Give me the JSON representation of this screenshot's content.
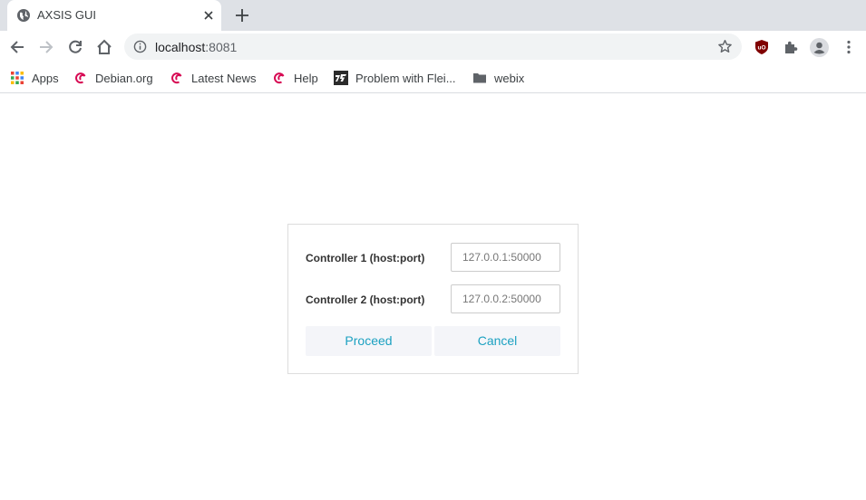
{
  "tab": {
    "title": "AXSIS GUI",
    "favicon": "globe-icon"
  },
  "omnibox": {
    "host": "localhost",
    "port": ":8081"
  },
  "bookmarks": [
    {
      "label": "Apps",
      "icon": "apps-grid-icon"
    },
    {
      "label": "Debian.org",
      "icon": "debian-swirl-icon"
    },
    {
      "label": "Latest News",
      "icon": "debian-swirl-icon"
    },
    {
      "label": "Help",
      "icon": "debian-swirl-icon"
    },
    {
      "label": "Problem with Flei...",
      "icon": "site-logo-icon"
    },
    {
      "label": "webix",
      "icon": "folder-icon"
    }
  ],
  "dialog": {
    "controller1": {
      "label": "Controller 1 (host:port)",
      "placeholder": "127.0.0.1:50000"
    },
    "controller2": {
      "label": "Controller 2 (host:port)",
      "placeholder": "127.0.0.2:50000"
    },
    "proceed_label": "Proceed",
    "cancel_label": "Cancel"
  },
  "colors": {
    "accent": "#1ca1c1",
    "debian": "#d70a53",
    "ublock": "#800000"
  }
}
